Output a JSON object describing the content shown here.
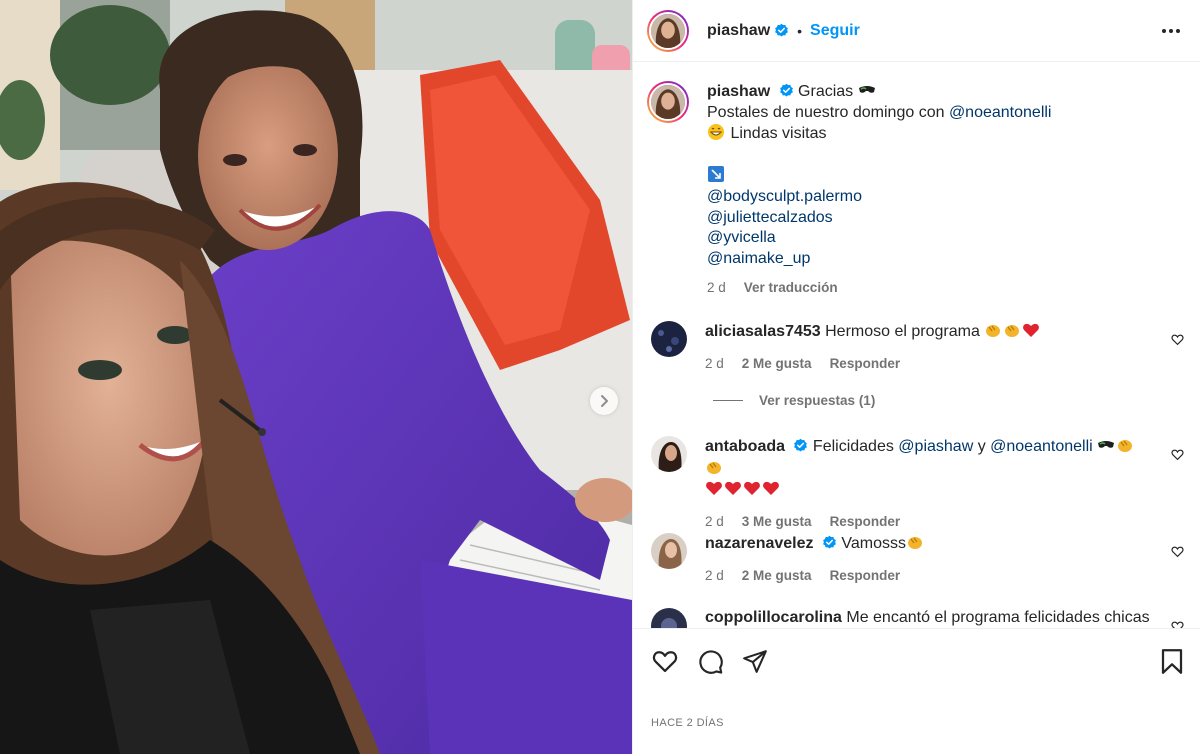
{
  "post": {
    "username": "piashaw",
    "follow_label": "Seguir",
    "dot": "•",
    "time_ago": "HACE 2 DÍAS"
  },
  "caption": {
    "username": "piashaw",
    "line1_text": "Gracias",
    "line2_text": "Postales de nuestro domingo con ",
    "line2_mention": "@noeantonelli",
    "line3_text": "Lindas visitas",
    "mentions": [
      "@bodysculpt.palermo",
      "@juliettecalzados",
      "@yvicella",
      "@naimake_up"
    ],
    "age": "2 d",
    "translate_label": "Ver traducción"
  },
  "comments": [
    {
      "username": "aliciasalas7453",
      "text": "Hermoso el programa",
      "age": "2 d",
      "likes": "2 Me gusta",
      "reply": "Responder"
    },
    {
      "username": "antaboada",
      "text_before": "Felicidades ",
      "mention1": "@piashaw",
      "and": " y ",
      "mention2": "@noeantonelli",
      "age": "2 d",
      "likes": "3 Me gusta",
      "reply": "Responder"
    },
    {
      "username": "nazarenavelez",
      "text": "Vamosss",
      "age": "2 d",
      "likes": "2 Me gusta",
      "reply": "Responder"
    },
    {
      "username": "coppolillocarolina",
      "text": "Me encantó el programa felicidades chicas"
    }
  ],
  "view_replies_label": "Ver respuestas (1)",
  "icons": {
    "like": "heart-icon",
    "comment": "comment-icon",
    "share": "paper-plane-icon",
    "save": "bookmark-icon",
    "more": "more-options-icon",
    "next": "chevron-right-icon",
    "verified": "verified-badge-icon"
  },
  "colors": {
    "accent": "#0095f6",
    "mention": "#00376b",
    "heart": "#ed2939",
    "verified": "#0095f6"
  }
}
